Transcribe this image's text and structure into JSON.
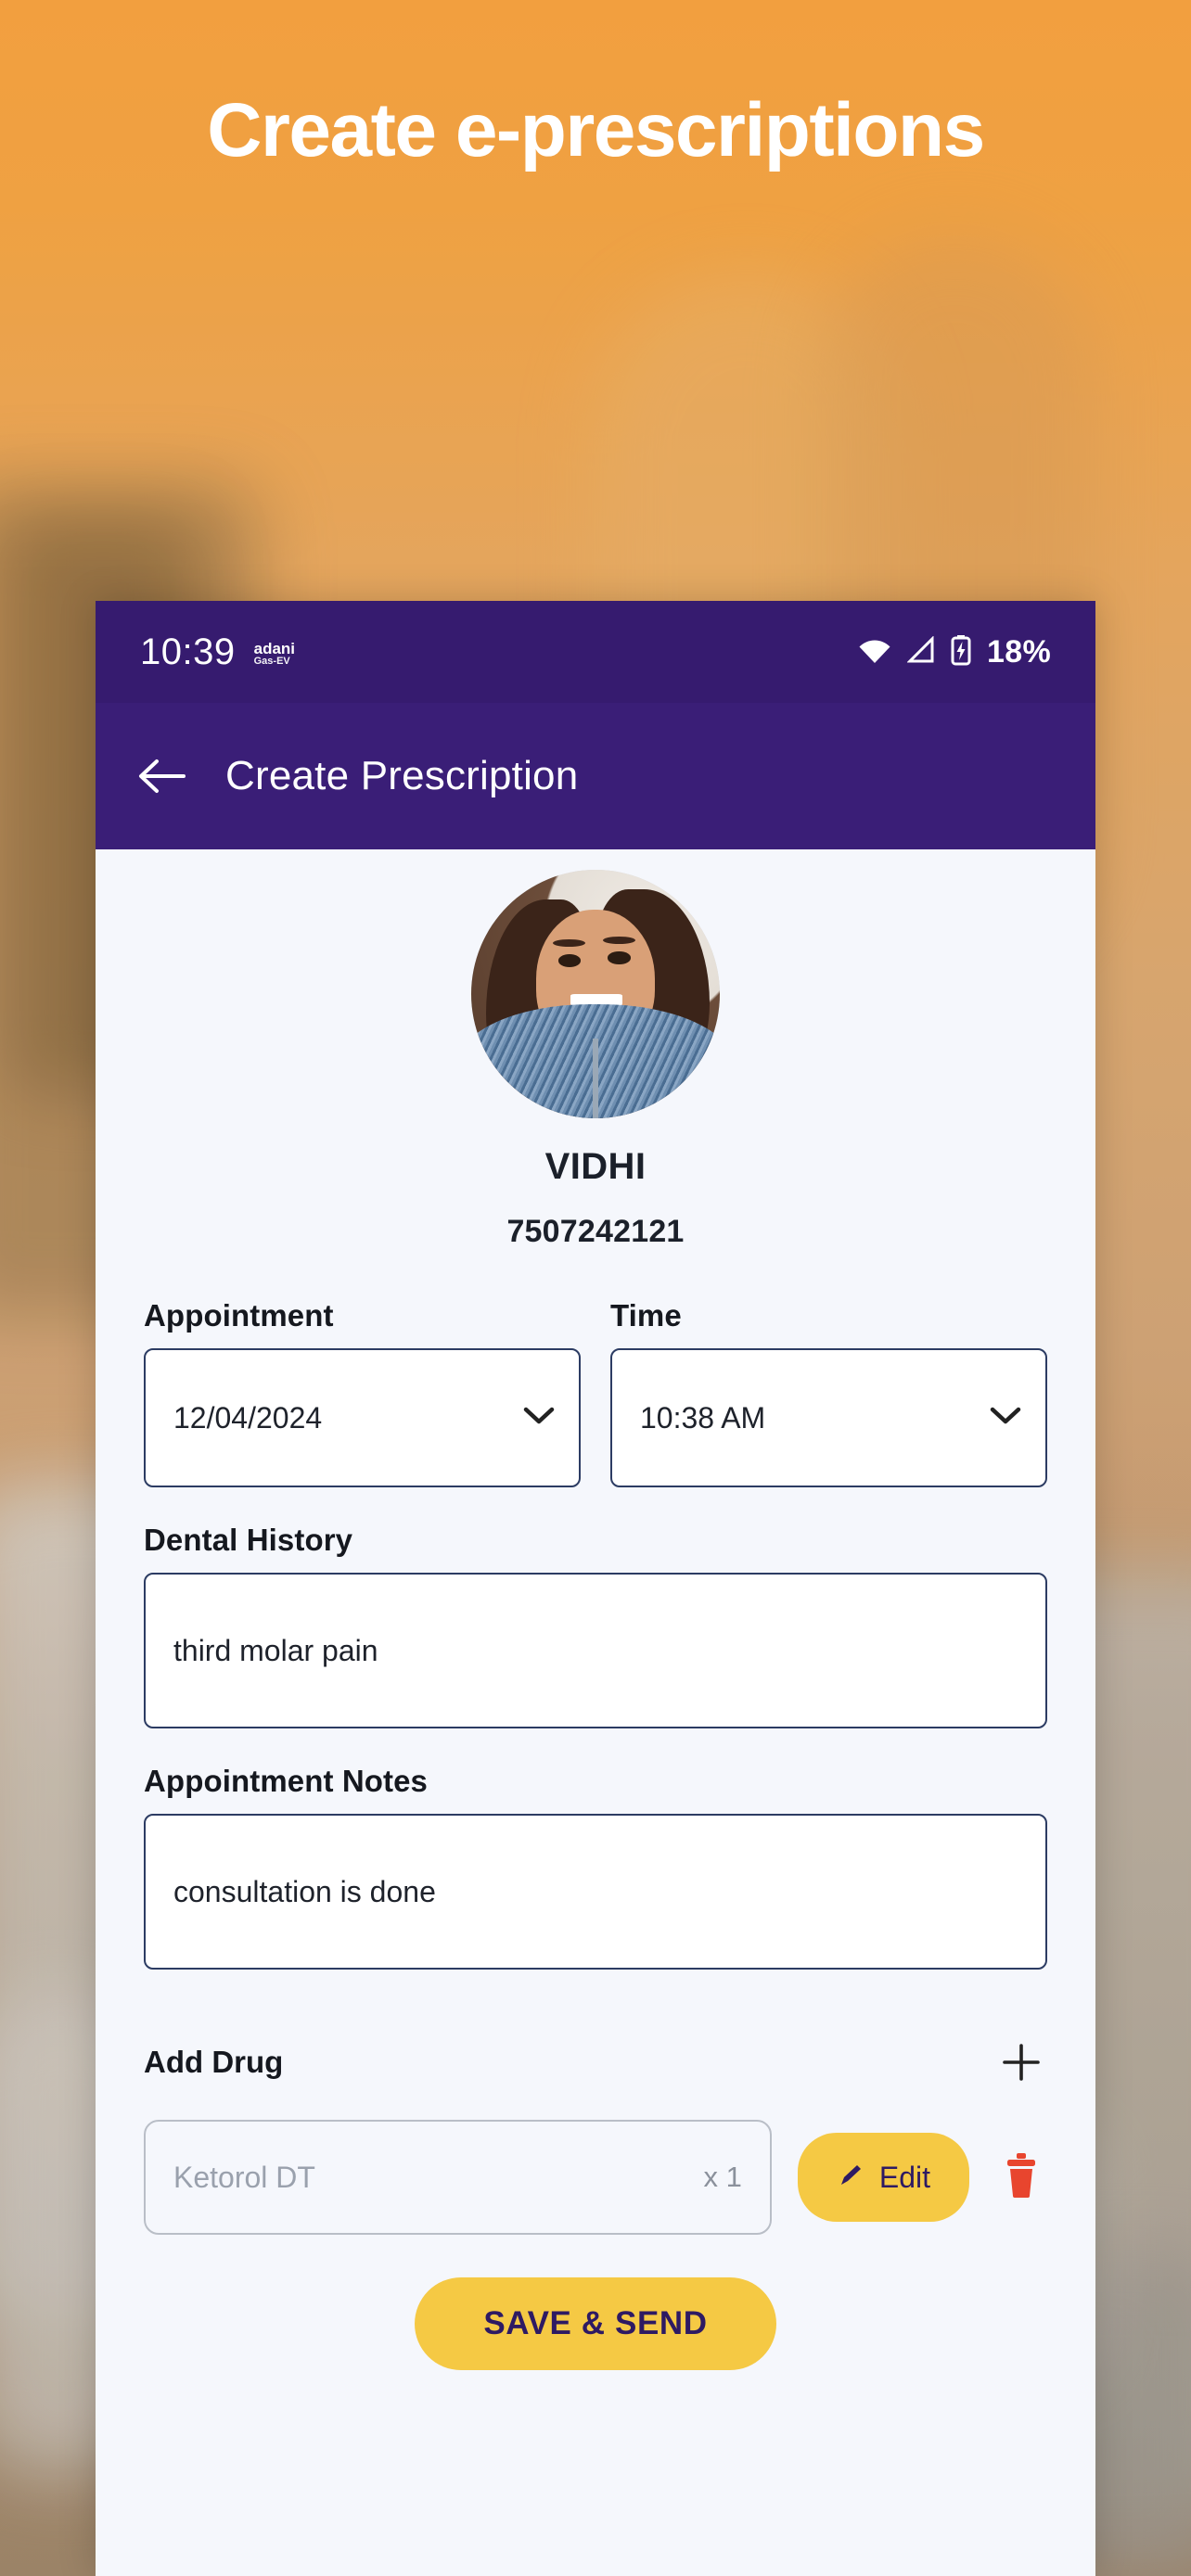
{
  "promo": {
    "heading": "Create e-prescriptions"
  },
  "status_bar": {
    "clock": "10:39",
    "carrier_name": "adani",
    "carrier_sub": "Gas-EV",
    "wifi_icon": "wifi-icon",
    "signal_icon": "signal-icon",
    "battery_icon": "battery-charging-icon",
    "battery_percent": "18%"
  },
  "app_bar": {
    "back_icon": "back-arrow-icon",
    "title": "Create Prescription"
  },
  "patient": {
    "avatar_alt": "patient-avatar",
    "name": "VIDHI",
    "phone": "7507242121"
  },
  "form": {
    "appointment": {
      "label": "Appointment",
      "value": "12/04/2024",
      "chevron_icon": "chevron-down-icon"
    },
    "time": {
      "label": "Time",
      "value": "10:38 AM",
      "chevron_icon": "chevron-down-icon"
    },
    "dental_history": {
      "label": "Dental History",
      "value": "third molar pain",
      "placeholder": "Dental History"
    },
    "appointment_notes": {
      "label": "Appointment Notes",
      "value": "consultation is done",
      "placeholder": "Appointment Notes"
    }
  },
  "drugs": {
    "title": "Add Drug",
    "add_icon": "plus-icon",
    "rows": [
      {
        "name_placeholder": "Ketorol DT",
        "quantity": "x 1",
        "edit_label": "Edit",
        "edit_icon": "pencil-icon",
        "delete_icon": "trash-icon"
      }
    ]
  },
  "actions": {
    "save_send_label": "SAVE & SEND"
  },
  "colors": {
    "status_bar_purple": "#361b6f",
    "app_bar_purple": "#3a1e77",
    "accent_yellow": "#f5c944",
    "delete_red": "#e8452e",
    "page_bg": "#f5f7fc",
    "field_border": "#2c3c63",
    "promo_orange": "#f6a13f"
  }
}
